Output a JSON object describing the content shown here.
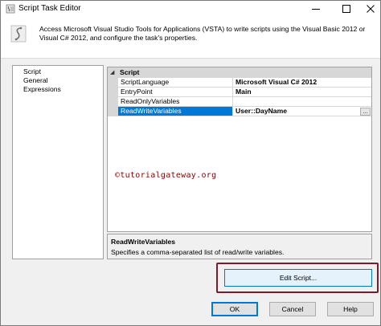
{
  "window": {
    "title": "Script Task Editor"
  },
  "header": {
    "description": "Access Microsoft Visual Studio Tools for Applications (VSTA) to write scripts using the Visual Basic 2012 or Visual C# 2012, and configure the task's properties."
  },
  "nav": {
    "items": [
      {
        "label": "Script"
      },
      {
        "label": "General"
      },
      {
        "label": "Expressions"
      }
    ]
  },
  "grid": {
    "category": "Script",
    "toggle": "◢",
    "rows": [
      {
        "name": "ScriptLanguage",
        "value": "Microsoft Visual C# 2012"
      },
      {
        "name": "EntryPoint",
        "value": "Main"
      },
      {
        "name": "ReadOnlyVariables",
        "value": ""
      },
      {
        "name": "ReadWriteVariables",
        "value": "User::DayName",
        "selected": true
      }
    ],
    "ellipsis": "..."
  },
  "watermark": "©tutorialgateway.org",
  "description_panel": {
    "title": "ReadWriteVariables",
    "text": "Specifies a comma-separated list of read/write variables."
  },
  "buttons": {
    "edit_script": "Edit Script...",
    "ok": "OK",
    "cancel": "Cancel",
    "help": "Help"
  },
  "colors": {
    "accent": "#0078d7",
    "highlight_box": "#7b1a2a",
    "watermark": "#8b0000"
  },
  "icons": {
    "app": "script-task-icon",
    "header": "script-icon",
    "minimize": "minimize-icon",
    "maximize": "maximize-icon",
    "close": "close-icon"
  }
}
